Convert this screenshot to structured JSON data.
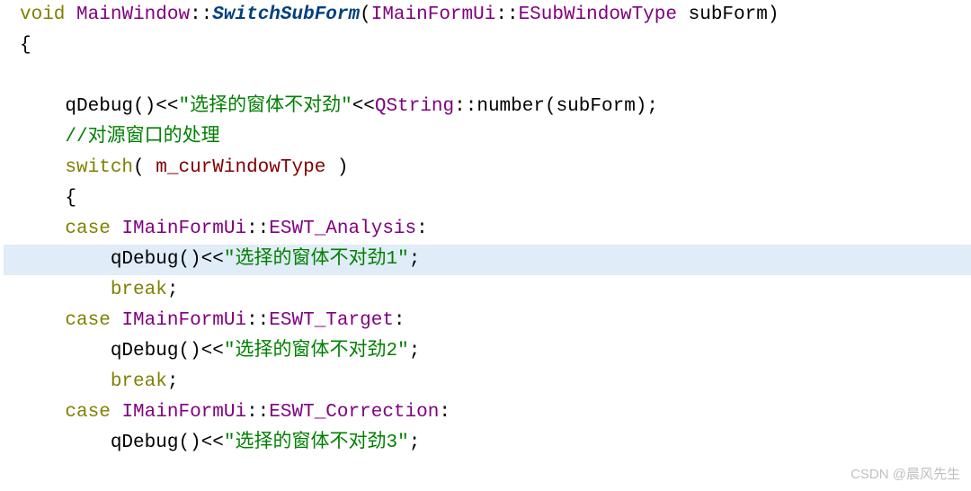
{
  "code": {
    "line1": {
      "kw_void": "void",
      "sp1": " ",
      "class1": "MainWindow",
      "scope1": "::",
      "method": "SwitchSubForm",
      "paren_open": "(",
      "class2": "IMainFormUi",
      "scope2": "::",
      "type2": "ESubWindowType",
      "sp2": " ",
      "param": "subForm",
      "paren_close": ")"
    },
    "line2": {
      "brace": "{"
    },
    "line3": {
      "empty": ""
    },
    "line4": {
      "indent": "    ",
      "func": "qDebug",
      "call": "()<<",
      "str": "\"选择的窗体不对劲\"",
      "op": "<<",
      "class1": "QString",
      "scope": "::",
      "func2": "number",
      "paren_open": "(",
      "arg": "subForm",
      "paren_close": ");"
    },
    "line5": {
      "indent": "    ",
      "comment": "//对源窗口的处理"
    },
    "line6": {
      "indent": "    ",
      "kw": "switch",
      "paren_open": "( ",
      "member": "m_curWindowType",
      "paren_close": " )"
    },
    "line7": {
      "indent": "    ",
      "brace": "{"
    },
    "line8": {
      "indent": "    ",
      "kw": "case",
      "sp": " ",
      "class1": "IMainFormUi",
      "scope": "::",
      "enum": "ESWT_Analysis",
      "colon": ":"
    },
    "line9": {
      "indent": "        ",
      "func": "qDebug",
      "call": "()<<",
      "str": "\"选择的窗体不对劲1\"",
      "semi": ";"
    },
    "line10": {
      "indent": "        ",
      "kw": "break",
      "semi": ";"
    },
    "line11": {
      "indent": "    ",
      "kw": "case",
      "sp": " ",
      "class1": "IMainFormUi",
      "scope": "::",
      "enum": "ESWT_Target",
      "colon": ":"
    },
    "line12": {
      "indent": "        ",
      "func": "qDebug",
      "call": "()<<",
      "str": "\"选择的窗体不对劲2\"",
      "semi": ";"
    },
    "line13": {
      "indent": "        ",
      "kw": "break",
      "semi": ";"
    },
    "line14": {
      "indent": "    ",
      "kw": "case",
      "sp": " ",
      "class1": "IMainFormUi",
      "scope": "::",
      "enum": "ESWT_Correction",
      "colon": ":"
    },
    "line15": {
      "indent": "        ",
      "func": "qDebug",
      "call": "()<<",
      "str": "\"选择的窗体不对劲3\"",
      "semi": ";"
    }
  },
  "watermark": "CSDN @晨风先生"
}
